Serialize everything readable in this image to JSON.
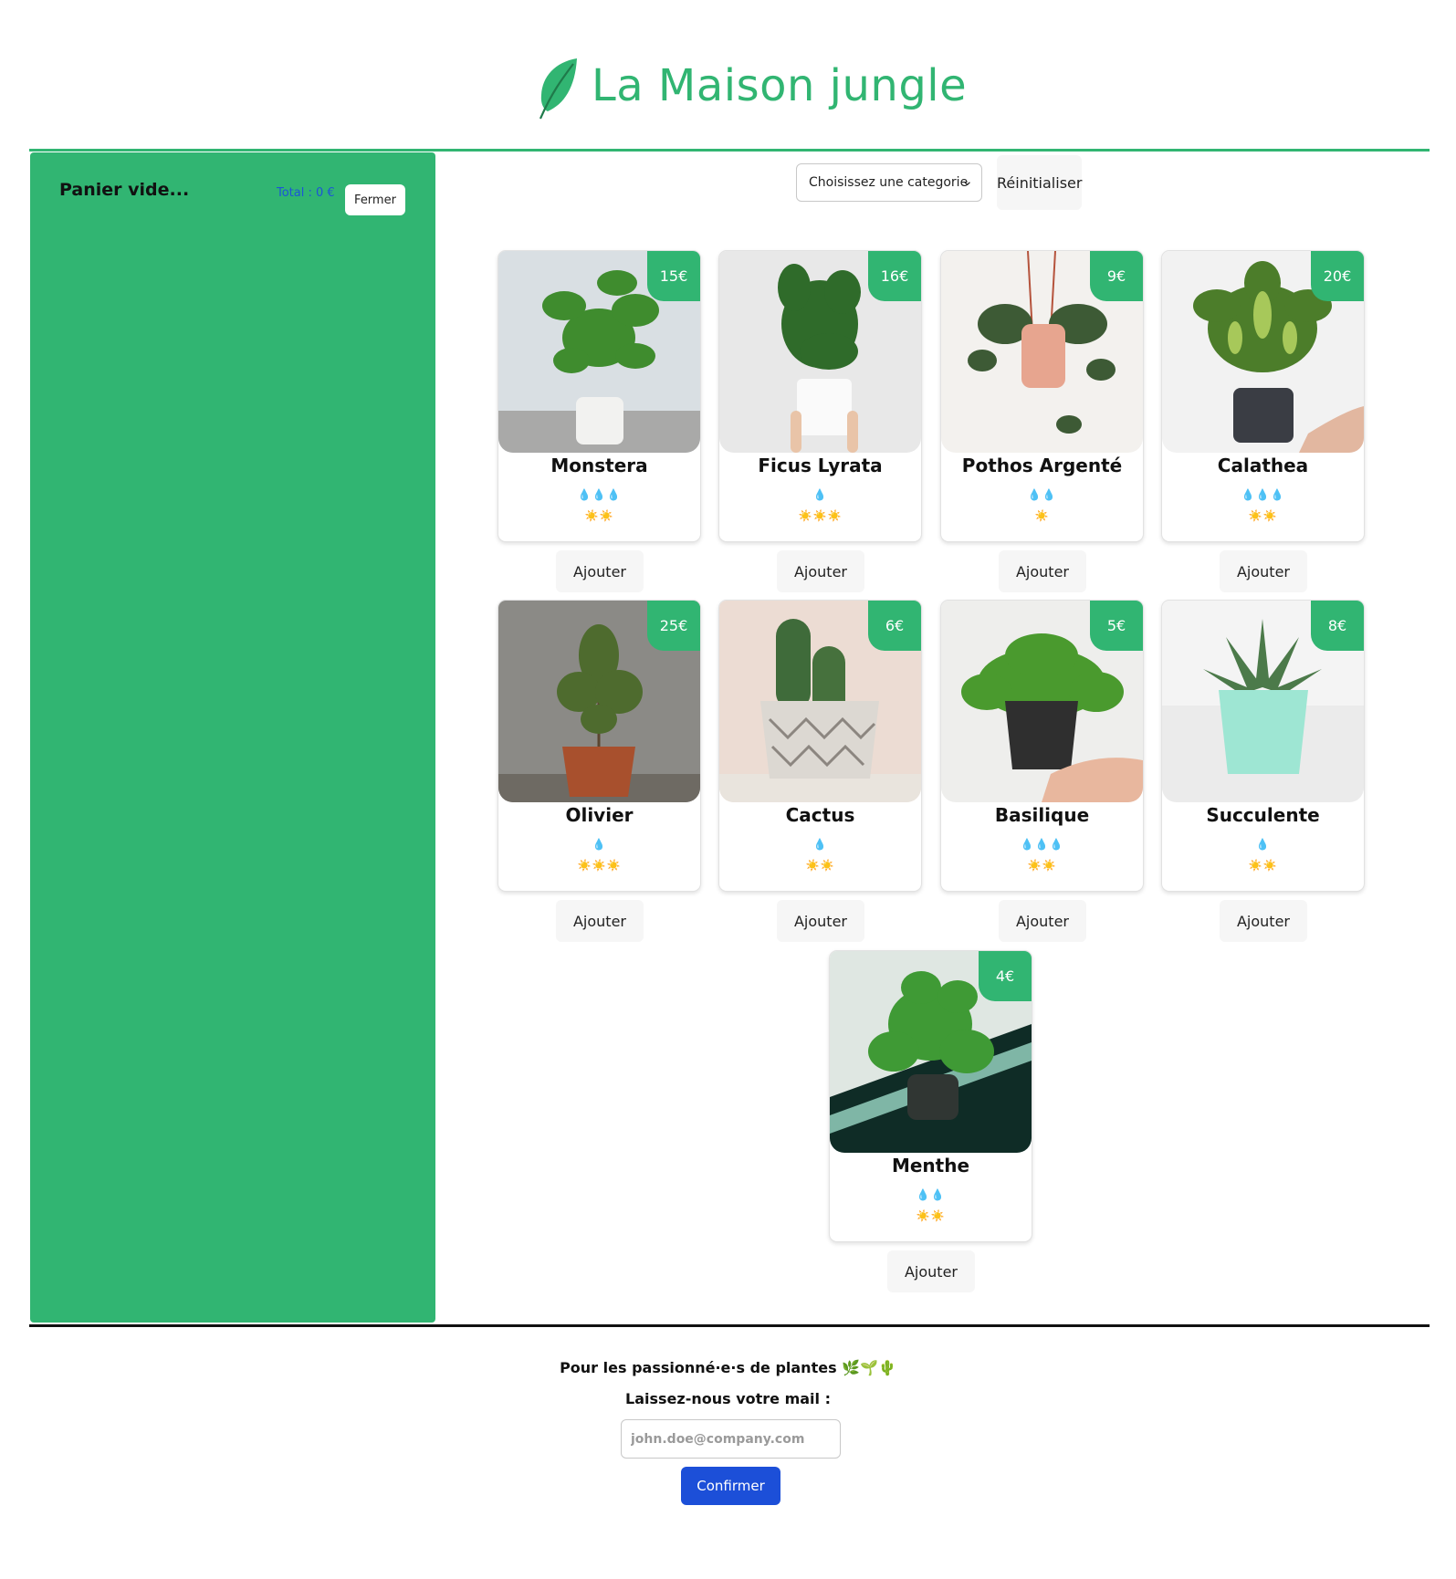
{
  "header": {
    "title": "La Maison jungle",
    "logo_icon": "leaf-icon",
    "accent_color": "#31b572"
  },
  "cart": {
    "title": "Panier vide...",
    "total_label": "Total : 0 €",
    "close_label": "Fermer"
  },
  "filter": {
    "selected": "Choisissez une categorie",
    "reset_label": "Réinitialiser"
  },
  "plants": [
    {
      "name": "Monstera",
      "price": "15€",
      "water": "💧💧💧",
      "light": "☀️☀️",
      "add_label": "Ajouter"
    },
    {
      "name": "Ficus Lyrata",
      "price": "16€",
      "water": "💧",
      "light": "☀️☀️☀️",
      "add_label": "Ajouter"
    },
    {
      "name": "Pothos Argenté",
      "price": "9€",
      "water": "💧💧",
      "light": "☀️",
      "add_label": "Ajouter"
    },
    {
      "name": "Calathea",
      "price": "20€",
      "water": "💧💧💧",
      "light": "☀️☀️",
      "add_label": "Ajouter"
    },
    {
      "name": "Olivier",
      "price": "25€",
      "water": "💧",
      "light": "☀️☀️☀️",
      "add_label": "Ajouter"
    },
    {
      "name": "Cactus",
      "price": "6€",
      "water": "💧",
      "light": "☀️☀️",
      "add_label": "Ajouter"
    },
    {
      "name": "Basilique",
      "price": "5€",
      "water": "💧💧💧",
      "light": "☀️☀️",
      "add_label": "Ajouter"
    },
    {
      "name": "Succulente",
      "price": "8€",
      "water": "💧",
      "light": "☀️☀️",
      "add_label": "Ajouter"
    },
    {
      "name": "Menthe",
      "price": "4€",
      "water": "💧💧",
      "light": "☀️☀️",
      "add_label": "Ajouter"
    }
  ],
  "footer": {
    "tagline": "Pour les passionné·e·s de plantes 🌿🌱🌵",
    "mail_prompt": "Laissez-nous votre mail :",
    "email_placeholder": "john.doe@company.com",
    "confirm_label": "Confirmer"
  }
}
